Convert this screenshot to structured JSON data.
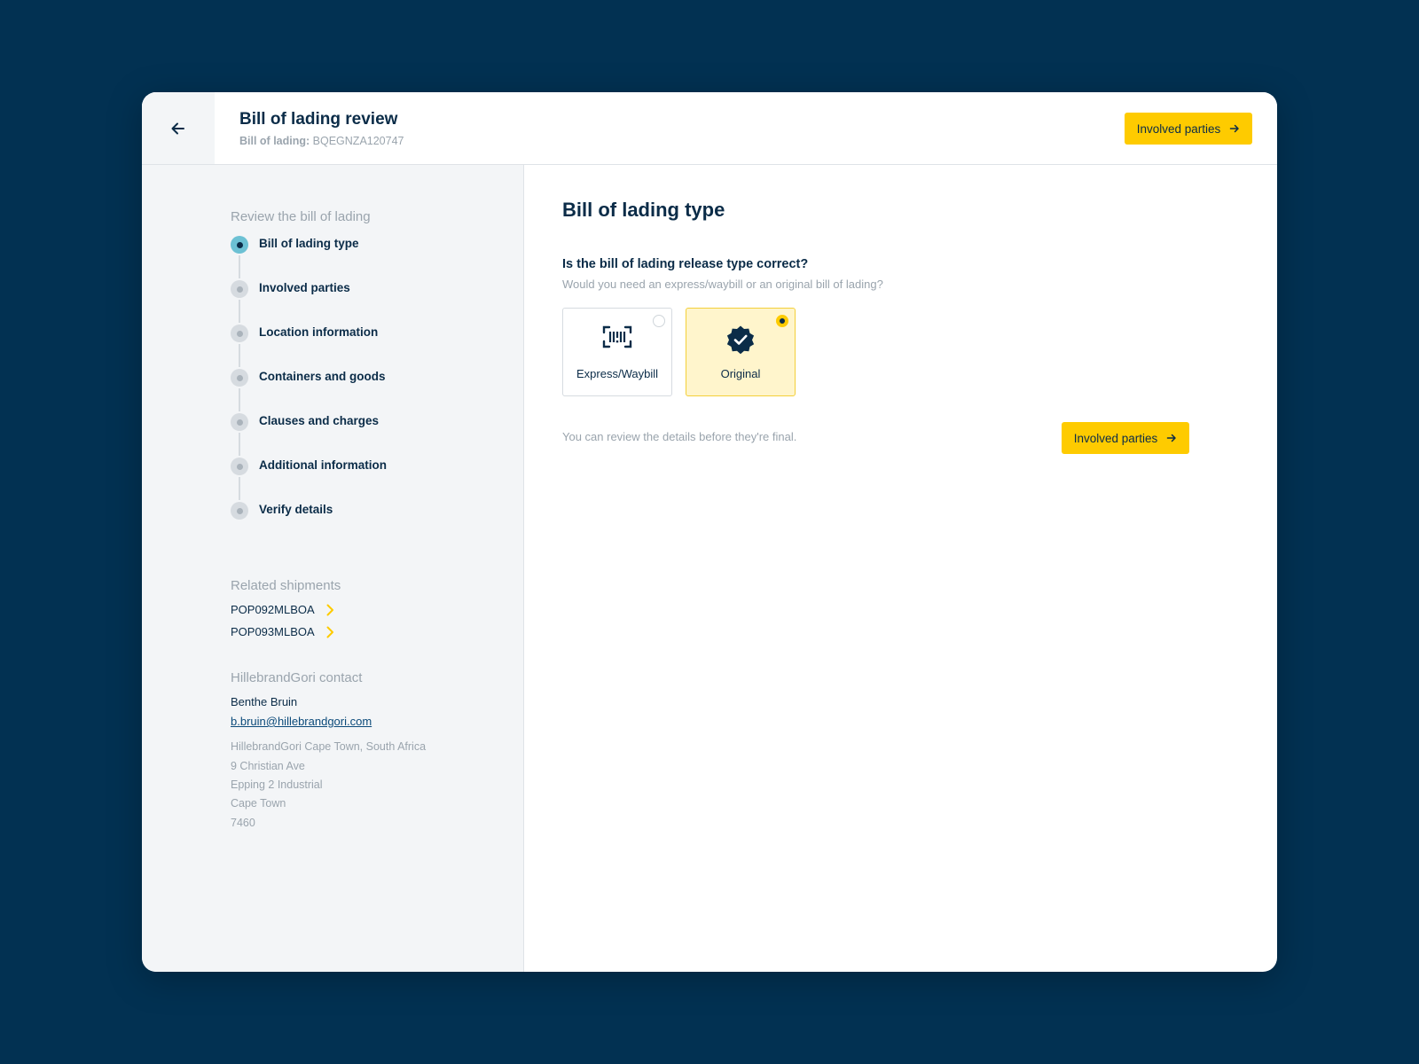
{
  "header": {
    "title": "Bill of lading review",
    "sub_label": "Bill of lading:",
    "sub_value": "BQEGNZA120747",
    "next_button": "Involved parties"
  },
  "sidebar": {
    "steps_heading": "Review the bill of lading",
    "steps": [
      {
        "label": "Bill of lading type",
        "active": true
      },
      {
        "label": "Involved parties",
        "active": false
      },
      {
        "label": "Location information",
        "active": false
      },
      {
        "label": "Containers and goods",
        "active": false
      },
      {
        "label": "Clauses and charges",
        "active": false
      },
      {
        "label": "Additional information",
        "active": false
      },
      {
        "label": "Verify details",
        "active": false
      }
    ],
    "related_heading": "Related shipments",
    "related": [
      "POP092MLBOA",
      "POP093MLBOA"
    ],
    "contact_heading": "HillebrandGori contact",
    "contact_name": "Benthe Bruin",
    "contact_email": "b.bruin@hillebrandgori.com",
    "address": [
      "HillebrandGori Cape Town, South Africa",
      "9 Christian Ave",
      "Epping 2 Industrial",
      "Cape Town",
      "7460"
    ]
  },
  "main": {
    "title": "Bill of lading type",
    "question": "Is the bill of lading release type correct?",
    "question_sub": "Would you need an express/waybill or an original bill of lading?",
    "options": [
      {
        "label": "Express/Waybill",
        "icon": "barcode-scan-icon",
        "selected": false
      },
      {
        "label": "Original",
        "icon": "verified-badge-icon",
        "selected": true
      }
    ],
    "footnote": "You can review the details before they're final.",
    "next_button": "Involved parties"
  },
  "colors": {
    "background": "#023152",
    "accent_yellow": "#fecb00",
    "active_step": "#6cc1d4",
    "text_dark": "#0b2c48",
    "text_muted": "#9aa4ad"
  }
}
